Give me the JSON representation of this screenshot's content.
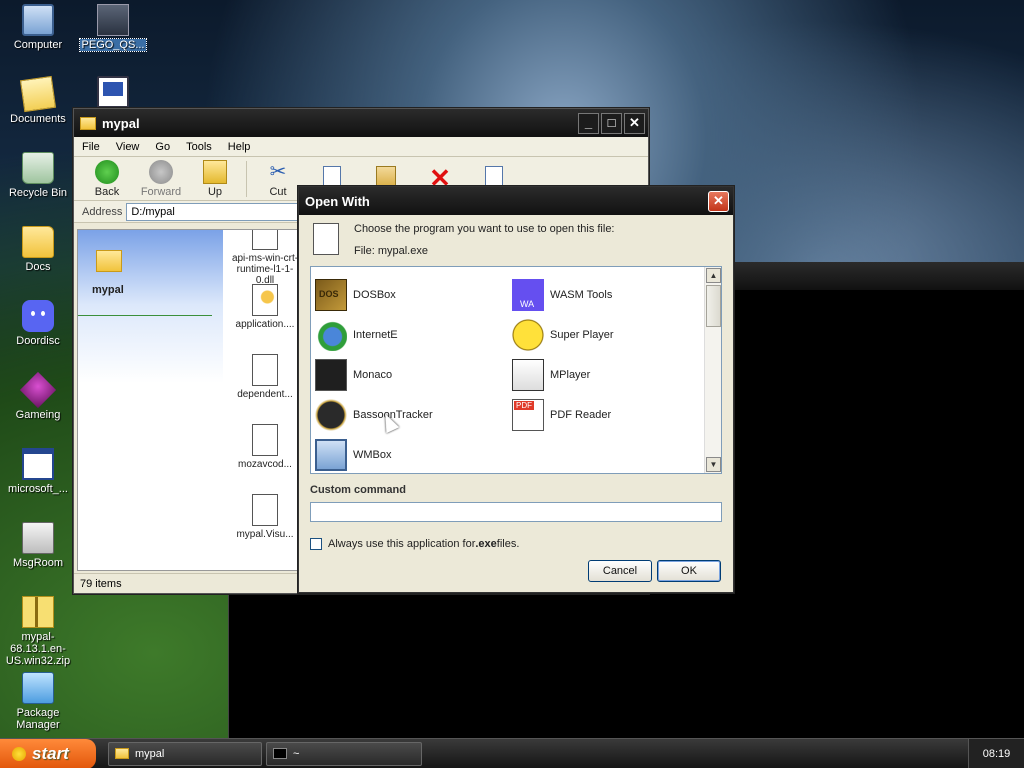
{
  "desktop": {
    "icons": [
      {
        "label": "Computer"
      },
      {
        "label": "PEGO_QS..."
      },
      {
        "label": "Documents"
      },
      {
        "label": "Recycle Bin"
      },
      {
        "label": "Docs"
      },
      {
        "label": "Doordisc"
      },
      {
        "label": "Gameing"
      },
      {
        "label": "microsoft_..."
      },
      {
        "label": "MsgRoom"
      },
      {
        "label": "mypal-68.13.1.en-US.win32.zip"
      },
      {
        "label": "Package Manager"
      }
    ]
  },
  "explorer": {
    "title": "mypal",
    "menu": [
      "File",
      "View",
      "Go",
      "Tools",
      "Help"
    ],
    "toolbar": {
      "back": "Back",
      "forward": "Forward",
      "up": "Up",
      "cut": "Cut"
    },
    "address_label": "Address",
    "address_value": "D:/mypal",
    "folder_name": "mypal",
    "files": [
      "api-ms-win-crt-runtime-l1-1-0.dll",
      "application....",
      "dependent...",
      "mozavcod...",
      "mypal.Visu..."
    ],
    "status": "79 items"
  },
  "dialog": {
    "title": "Open With",
    "prompt": "Choose the program you want to use to open this file:",
    "file_label": "File: mypal.exe",
    "programs": [
      {
        "name": "DOSBox",
        "icon": "dosbox-icon"
      },
      {
        "name": "WASM Tools",
        "icon": "wasm-icon"
      },
      {
        "name": "InternetE",
        "icon": "internet-explorer-icon"
      },
      {
        "name": "Super Player",
        "icon": "smiley-icon"
      },
      {
        "name": "Monaco",
        "icon": "monaco-icon"
      },
      {
        "name": "MPlayer",
        "icon": "clapperboard-icon"
      },
      {
        "name": "BassoonTracker",
        "icon": "bassoontracker-icon"
      },
      {
        "name": "PDF Reader",
        "icon": "pdf-icon"
      },
      {
        "name": "WMBox",
        "icon": "computer-icon"
      }
    ],
    "custom_command_label": "Custom command",
    "custom_command_value": "",
    "always_use_prefix": "Always use this application for ",
    "always_use_ext": ".exe",
    "always_use_suffix": " files.",
    "cancel_label": "Cancel",
    "ok_label": "OK"
  },
  "taskbar": {
    "start_label": "start",
    "tasks": [
      {
        "label": "mypal"
      },
      {
        "label": "~"
      }
    ],
    "clock": "08:19"
  }
}
